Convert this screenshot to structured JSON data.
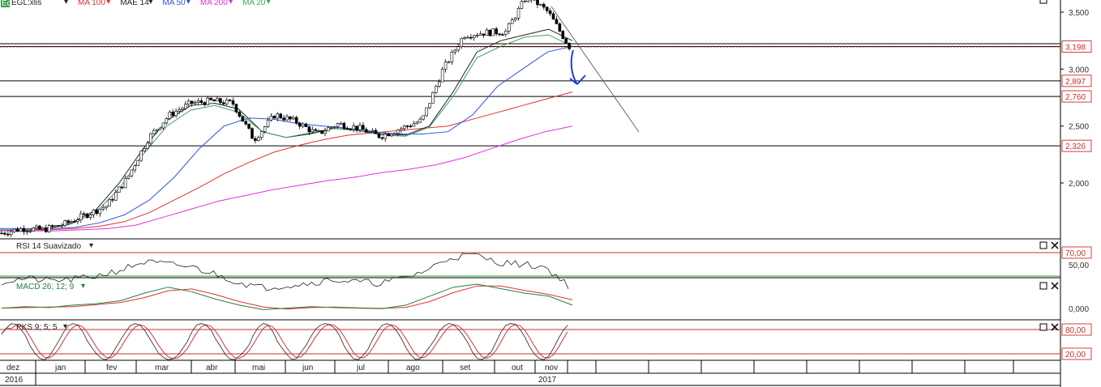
{
  "header": {
    "symbol_badge": "Eq",
    "symbol": "EGL:xlis",
    "indicators": [
      {
        "label": "MA 100",
        "color": "#e03030"
      },
      {
        "label": "MAE 14",
        "color": "#222222"
      },
      {
        "label": "MA 50",
        "color": "#3050e0"
      },
      {
        "label": "MA 200",
        "color": "#e030e0"
      },
      {
        "label": "MA 20",
        "color": "#40a060"
      }
    ]
  },
  "panels": {
    "rsi": {
      "label": "RSI 14 Suavizado"
    },
    "macd": {
      "label": "MACD 26; 12; 9"
    },
    "pks": {
      "label": "PKS 9; 5; 5"
    }
  },
  "price_axis": {
    "ticks": [
      "3,500",
      "3,000",
      "2,500",
      "2,000"
    ],
    "highlight_levels": [
      "3,198",
      "2,897",
      "2,760",
      "2,326"
    ]
  },
  "rsi_axis": {
    "ticks": [
      "70,00",
      "50,00"
    ]
  },
  "macd_axis": {
    "ticks": [
      "0,000"
    ]
  },
  "pks_axis": {
    "ticks": [
      "80,00",
      "20,00"
    ]
  },
  "time_axis": {
    "months": [
      "dez",
      "jan",
      "fev",
      "mar",
      "abr",
      "mai",
      "jun",
      "jul",
      "ago",
      "set",
      "out",
      "nov"
    ],
    "years": [
      "2016",
      "2017"
    ]
  },
  "chart_data": {
    "type": "candlestick",
    "symbol": "EGL:xlis",
    "x_months": [
      "dez",
      "jan",
      "fev",
      "mar",
      "abr",
      "mai",
      "jun",
      "jul",
      "ago",
      "set",
      "out",
      "nov"
    ],
    "price_ylim": [
      1500,
      3650
    ],
    "price_ticks": [
      3500,
      3000,
      2500,
      2000
    ],
    "price_close_approx": [
      1560,
      1600,
      1590,
      1640,
      1720,
      1800,
      2050,
      2400,
      2600,
      2700,
      2720,
      2700,
      2380,
      2600,
      2540,
      2430,
      2520,
      2480,
      2410,
      2480,
      2550,
      3000,
      3300,
      3320,
      3330,
      3650,
      3500,
      3198
    ],
    "horizontal_levels": [
      3198,
      2897,
      2760,
      2326
    ],
    "series": [
      {
        "name": "MA 100",
        "color": "#e03030",
        "values": [
          1580,
          1585,
          1590,
          1600,
          1620,
          1660,
          1740,
          1850,
          1960,
          2080,
          2180,
          2270,
          2330,
          2380,
          2420,
          2440,
          2460,
          2480,
          2500,
          2560,
          2620,
          2680,
          2740,
          2800
        ]
      },
      {
        "name": "MAE 14",
        "color": "#222222",
        "values": [
          1580,
          1590,
          1600,
          1650,
          1760,
          2000,
          2300,
          2550,
          2680,
          2700,
          2650,
          2450,
          2400,
          2430,
          2480,
          2460,
          2430,
          2420,
          2500,
          2800,
          3150,
          3250,
          3300,
          3350,
          3250
        ]
      },
      {
        "name": "MA 50",
        "color": "#3050e0",
        "values": [
          1600,
          1600,
          1600,
          1610,
          1650,
          1720,
          1850,
          2050,
          2300,
          2500,
          2570,
          2560,
          2520,
          2500,
          2480,
          2450,
          2430,
          2430,
          2450,
          2600,
          2850,
          3000,
          3150,
          3200
        ]
      },
      {
        "name": "MA 200",
        "color": "#e030e0",
        "values": [
          1580,
          1580,
          1580,
          1590,
          1600,
          1630,
          1700,
          1770,
          1840,
          1890,
          1940,
          1980,
          2020,
          2050,
          2090,
          2120,
          2160,
          2220,
          2300,
          2380,
          2450,
          2500
        ]
      },
      {
        "name": "MA 20",
        "color": "#40a060",
        "values": [
          1590,
          1590,
          1600,
          1640,
          1740,
          1950,
          2250,
          2500,
          2640,
          2680,
          2620,
          2450,
          2400,
          2440,
          2480,
          2460,
          2420,
          2410,
          2490,
          2760,
          3100,
          3200,
          3280,
          3300,
          3200
        ]
      }
    ],
    "rsi": {
      "label": "RSI 14 Suavizado",
      "levels": [
        70,
        50
      ],
      "values": [
        45,
        48,
        46,
        47,
        50,
        55,
        62,
        60,
        58,
        52,
        45,
        40,
        42,
        44,
        47,
        45,
        44,
        48,
        55,
        66,
        68,
        62,
        60,
        58,
        42
      ]
    },
    "macd": {
      "label": "MACD 26; 12; 9",
      "zero_line": 0
    },
    "pks": {
      "label": "PKS 9; 5; 5",
      "levels": [
        80,
        20
      ]
    }
  }
}
